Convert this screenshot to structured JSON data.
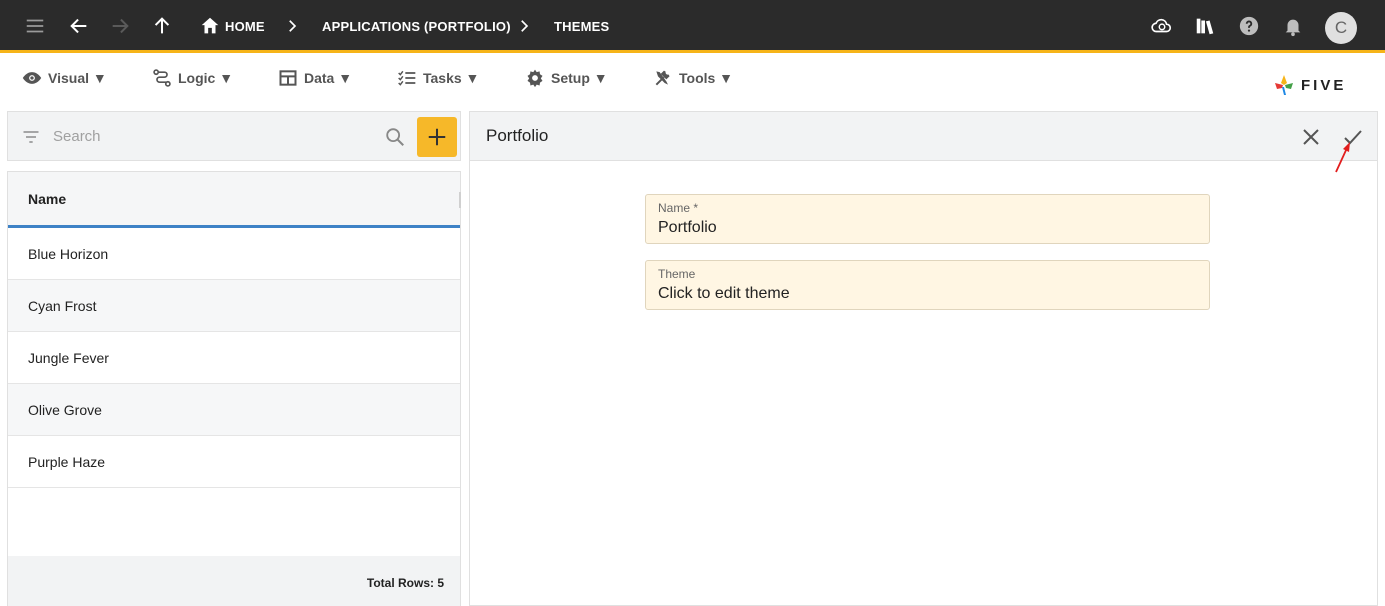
{
  "topbar": {
    "breadcrumbs": [
      "HOME",
      "APPLICATIONS (PORTFOLIO)",
      "THEMES"
    ],
    "avatar_letter": "C"
  },
  "menu": {
    "items": [
      {
        "label": "Visual ▼",
        "icon": "eye-icon"
      },
      {
        "label": "Logic ▼",
        "icon": "logic-icon"
      },
      {
        "label": "Data ▼",
        "icon": "table-icon"
      },
      {
        "label": "Tasks ▼",
        "icon": "tasks-icon"
      },
      {
        "label": "Setup ▼",
        "icon": "gear-icon"
      },
      {
        "label": "Tools ▼",
        "icon": "tools-icon"
      }
    ],
    "logo_text": "FIVE"
  },
  "list": {
    "search_placeholder": "Search",
    "column_header": "Name",
    "rows": [
      "Blue Horizon",
      "Cyan Frost",
      "Jungle Fever",
      "Olive Grove",
      "Purple Haze"
    ],
    "footer": "Total Rows: 5"
  },
  "form": {
    "title": "Portfolio",
    "fields": [
      {
        "label": "Name *",
        "value": "Portfolio"
      },
      {
        "label": "Theme",
        "value": "Click to edit theme"
      }
    ]
  },
  "colors": {
    "accent": "#f6b418",
    "header_underline": "#3e82c6",
    "field_bg": "#fff6e3",
    "annotation_arrow": "#e21d1d"
  }
}
